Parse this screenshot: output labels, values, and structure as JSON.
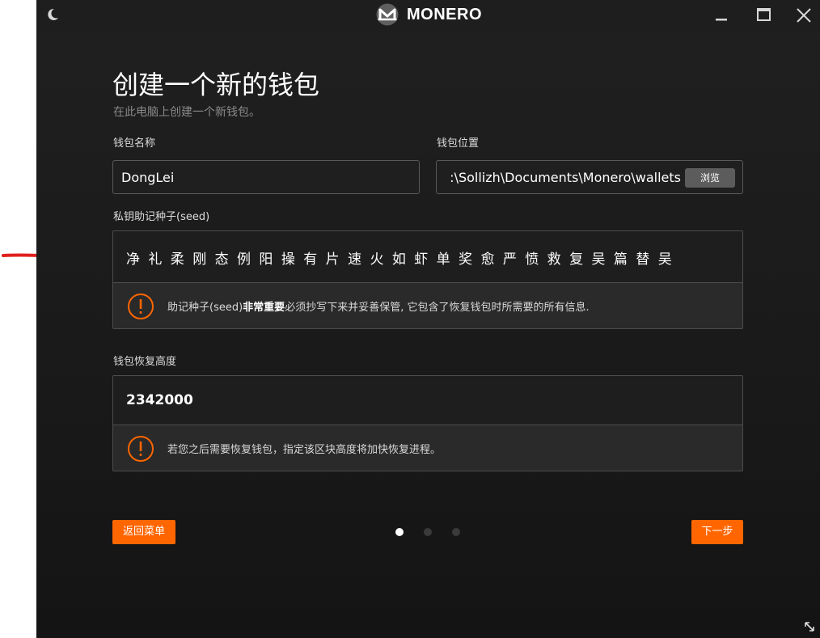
{
  "titlebar": {
    "brand": "MONERO",
    "icons": {
      "theme": "moon-icon",
      "logo": "monero-logo-icon",
      "minimize": "minimize-icon",
      "maximize": "maximize-icon",
      "close": "close-icon"
    }
  },
  "page": {
    "title": "创建一个新的钱包",
    "subtitle": "在此电脑上创建一个新钱包。"
  },
  "wallet_name": {
    "label": "钱包名称",
    "value": "DongLei"
  },
  "wallet_location": {
    "label": "钱包位置",
    "value": ":\\Sollizh\\Documents\\Monero\\wallets",
    "browse_label": "浏览"
  },
  "seed": {
    "label": "私钥助记种子(seed)",
    "words": "净 礼 柔 刚 态 例 阳 操 有 片 速 火 如 虾 单 奖 愈 严 愤 救 复 吴 篇 替 吴",
    "warning_prefix": "助记种子(seed)",
    "warning_emphasis": "非常重要",
    "warning_suffix": "必须抄写下来并妥善保管, 它包含了恢复钱包时所需要的所有信息."
  },
  "restore_height": {
    "label": "钱包恢复高度",
    "value": "2342000",
    "warning": "若您之后需要恢复钱包，指定该区块高度将加快恢复进程。"
  },
  "navigation": {
    "back_label": "返回菜单",
    "next_label": "下一步",
    "current_step": 1,
    "total_steps": 3
  },
  "colors": {
    "accent": "#ff6600",
    "background": "#1a1a1a",
    "annotation_arrow": "#e0201c"
  }
}
